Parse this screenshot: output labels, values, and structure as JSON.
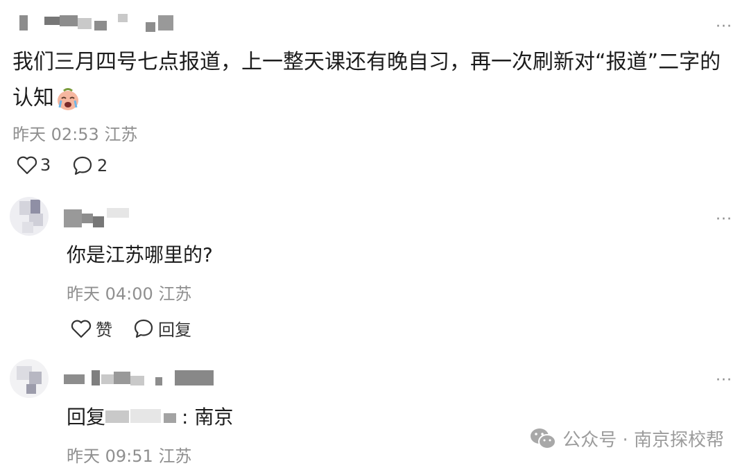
{
  "post": {
    "text": "我们三月四号七点报道，上一整天课还有晚自习，再一次刷新对“报道”二字的",
    "text_line2": "认知",
    "emoji": "crying-face-emoji",
    "time": "昨天 02:53",
    "location": "江苏",
    "like_count": "3",
    "comment_count": "2",
    "more": "···"
  },
  "replies": [
    {
      "text": "你是江苏哪里的?",
      "time": "昨天 04:00",
      "location": "江苏",
      "like_label": "赞",
      "reply_label": "回复",
      "more": "···"
    },
    {
      "text_prefix": "回复",
      "text_suffix": ": 南京",
      "time": "昨天 09:51",
      "location": "江苏",
      "more": "···"
    }
  ],
  "watermark": {
    "text": "公众号 · 南京探校帮",
    "icon": "wechat-icon"
  },
  "colors": {
    "meta_gray": "#8f8f8f",
    "text": "#1c1c1c"
  }
}
